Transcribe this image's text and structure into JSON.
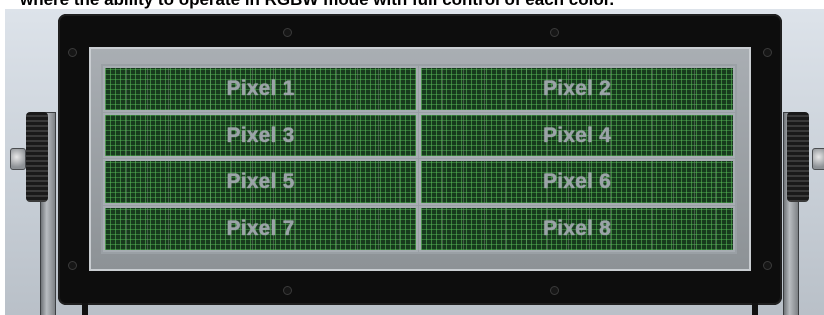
{
  "caption": "where the ability to operate in RGBW mode with full control of each color.",
  "fixture": {
    "pixels": [
      {
        "label": "Pixel 1"
      },
      {
        "label": "Pixel 2"
      },
      {
        "label": "Pixel 3"
      },
      {
        "label": "Pixel 4"
      },
      {
        "label": "Pixel 5"
      },
      {
        "label": "Pixel 6"
      },
      {
        "label": "Pixel 7"
      },
      {
        "label": "Pixel 8"
      }
    ]
  },
  "colors": {
    "housing": "#0d0d0d",
    "led_green": "#173a1d",
    "label_gray": "#9ba3a8",
    "background": "#ffffff"
  }
}
